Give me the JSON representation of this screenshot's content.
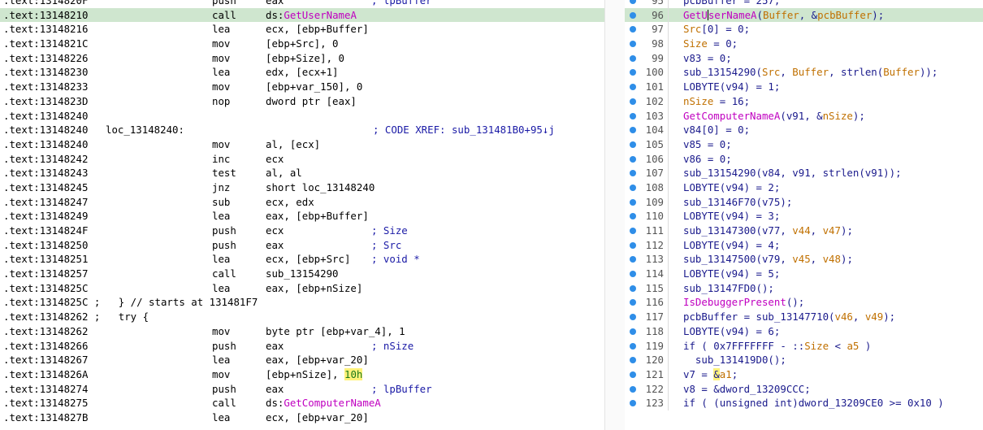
{
  "asm_lines": [
    {
      "addr": ".text:1314820F",
      "label": "",
      "mnemonic": "push",
      "operand": "eax",
      "comment": "; lpBuffer"
    },
    {
      "addr": ".text:13148210",
      "label": "",
      "mnemonic": "call",
      "operand_prefix": "ds:",
      "operand_fn": "GetUserNameA",
      "highlight": true
    },
    {
      "addr": ".text:13148216",
      "label": "",
      "mnemonic": "lea",
      "operand": "ecx, [ebp+Buffer]"
    },
    {
      "addr": ".text:1314821C",
      "label": "",
      "mnemonic": "mov",
      "operand": "[ebp+Src], 0"
    },
    {
      "addr": ".text:13148226",
      "label": "",
      "mnemonic": "mov",
      "operand": "[ebp+Size], 0"
    },
    {
      "addr": ".text:13148230",
      "label": "",
      "mnemonic": "lea",
      "operand": "edx, [ecx+1]"
    },
    {
      "addr": ".text:13148233",
      "label": "",
      "mnemonic": "mov",
      "operand": "[ebp+var_150], 0"
    },
    {
      "addr": ".text:1314823D",
      "label": "",
      "mnemonic": "nop",
      "operand": "dword ptr [eax]"
    },
    {
      "addr": ".text:13148240",
      "label": "",
      "mnemonic": "",
      "operand": ""
    },
    {
      "addr": ".text:13148240",
      "label": "loc_13148240:",
      "mnemonic": "",
      "operand": "",
      "comment": "; CODE XREF: sub_131481B0+95↓j"
    },
    {
      "addr": ".text:13148240",
      "label": "",
      "mnemonic": "mov",
      "operand": "al, [ecx]"
    },
    {
      "addr": ".text:13148242",
      "label": "",
      "mnemonic": "inc",
      "operand": "ecx"
    },
    {
      "addr": ".text:13148243",
      "label": "",
      "mnemonic": "test",
      "operand": "al, al"
    },
    {
      "addr": ".text:13148245",
      "label": "",
      "mnemonic": "jnz",
      "operand": "short loc_13148240"
    },
    {
      "addr": ".text:13148247",
      "label": "",
      "mnemonic": "sub",
      "operand": "ecx, edx"
    },
    {
      "addr": ".text:13148249",
      "label": "",
      "mnemonic": "lea",
      "operand": "eax, [ebp+Buffer]"
    },
    {
      "addr": ".text:1314824F",
      "label": "",
      "mnemonic": "push",
      "operand": "ecx",
      "comment": "; Size"
    },
    {
      "addr": ".text:13148250",
      "label": "",
      "mnemonic": "push",
      "operand": "eax",
      "comment": "; Src"
    },
    {
      "addr": ".text:13148251",
      "label": "",
      "mnemonic": "lea",
      "operand": "ecx, [ebp+Src]",
      "comment": "; void *"
    },
    {
      "addr": ".text:13148257",
      "label": "",
      "mnemonic": "call",
      "operand": "sub_13154290"
    },
    {
      "addr": ".text:1314825C",
      "label": "",
      "mnemonic": "lea",
      "operand": "eax, [ebp+nSize]"
    },
    {
      "full": ".text:1314825C ;   } // starts at 131481F7"
    },
    {
      "full": ".text:13148262 ;   try {"
    },
    {
      "addr": ".text:13148262",
      "label": "",
      "mnemonic": "mov",
      "operand": "byte ptr [ebp+var_4], 1"
    },
    {
      "addr": ".text:13148266",
      "label": "",
      "mnemonic": "push",
      "operand": "eax",
      "comment": "; nSize"
    },
    {
      "addr": ".text:13148267",
      "label": "",
      "mnemonic": "lea",
      "operand": "eax, [ebp+var_20]"
    },
    {
      "addr": ".text:1314826A",
      "label": "",
      "mnemonic": "mov",
      "operand_prefix": "[ebp+nSize], ",
      "operand_hl": "10h"
    },
    {
      "addr": ".text:13148274",
      "label": "",
      "mnemonic": "push",
      "operand": "eax",
      "comment": "; lpBuffer"
    },
    {
      "addr": ".text:13148275",
      "label": "",
      "mnemonic": "call",
      "operand_prefix": "ds:",
      "operand_fn": "GetComputerNameA"
    },
    {
      "addr": ".text:1314827B",
      "label": "",
      "mnemonic": "lea",
      "operand": "ecx, [ebp+var_20]"
    }
  ],
  "pseudo_lines": [
    {
      "n": "95",
      "t": "pcbBuffer = 257;"
    },
    {
      "n": "96",
      "highlight": true,
      "parts": [
        [
          "fnr",
          "GetU"
        ],
        [
          "caret",
          ""
        ],
        [
          "fnr",
          "serNameA"
        ],
        [
          "",
          "("
        ],
        [
          "varr",
          "Buffer"
        ],
        [
          "",
          ", &"
        ],
        [
          "varr",
          "pcbBuffer"
        ],
        [
          "",
          ");"
        ]
      ]
    },
    {
      "n": "97",
      "parts": [
        [
          "varr",
          "Src"
        ],
        [
          "",
          "[0] = 0;"
        ]
      ]
    },
    {
      "n": "98",
      "parts": [
        [
          "varr",
          "Size"
        ],
        [
          "",
          " = 0;"
        ]
      ]
    },
    {
      "n": "99",
      "t": "v83 = 0;"
    },
    {
      "n": "100",
      "parts": [
        [
          "",
          "sub_13154290("
        ],
        [
          "varr",
          "Src"
        ],
        [
          "",
          ", "
        ],
        [
          "varr",
          "Buffer"
        ],
        [
          "",
          ", strlen("
        ],
        [
          "varr",
          "Buffer"
        ],
        [
          "",
          "));"
        ]
      ]
    },
    {
      "n": "101",
      "t": "LOBYTE(v94) = 1;"
    },
    {
      "n": "102",
      "parts": [
        [
          "varr",
          "nSize"
        ],
        [
          "",
          " = 16;"
        ]
      ]
    },
    {
      "n": "103",
      "parts": [
        [
          "fnr",
          "GetComputerNameA"
        ],
        [
          "",
          "(v91, &"
        ],
        [
          "varr",
          "nSize"
        ],
        [
          "",
          ");"
        ]
      ]
    },
    {
      "n": "104",
      "t": "v84[0] = 0;"
    },
    {
      "n": "105",
      "t": "v85 = 0;"
    },
    {
      "n": "106",
      "t": "v86 = 0;"
    },
    {
      "n": "107",
      "t": "sub_13154290(v84, v91, strlen(v91));"
    },
    {
      "n": "108",
      "t": "LOBYTE(v94) = 2;"
    },
    {
      "n": "109",
      "t": "sub_13146F70(v75);"
    },
    {
      "n": "110",
      "t": "LOBYTE(v94) = 3;"
    },
    {
      "n": "111",
      "parts": [
        [
          "",
          "sub_13147300(v77, "
        ],
        [
          "varr",
          "v44"
        ],
        [
          "",
          ", "
        ],
        [
          "varr",
          "v47"
        ],
        [
          "",
          ");"
        ]
      ]
    },
    {
      "n": "112",
      "t": "LOBYTE(v94) = 4;"
    },
    {
      "n": "113",
      "parts": [
        [
          "",
          "sub_13147500(v79, "
        ],
        [
          "varr",
          "v45"
        ],
        [
          "",
          ", "
        ],
        [
          "varr",
          "v48"
        ],
        [
          "",
          ");"
        ]
      ]
    },
    {
      "n": "114",
      "t": "LOBYTE(v94) = 5;"
    },
    {
      "n": "115",
      "t": "sub_13147FD0();"
    },
    {
      "n": "116",
      "parts": [
        [
          "fnr",
          "IsDebuggerPresent"
        ],
        [
          "",
          "();"
        ]
      ]
    },
    {
      "n": "117",
      "parts": [
        [
          "",
          "pcbBuffer = sub_13147710("
        ],
        [
          "varr",
          "v46"
        ],
        [
          "",
          ", "
        ],
        [
          "varr",
          "v49"
        ],
        [
          "",
          ");"
        ]
      ]
    },
    {
      "n": "118",
      "t": "LOBYTE(v94) = 6;"
    },
    {
      "n": "119",
      "parts": [
        [
          "",
          "if ( 0x7FFFFFFF - ::"
        ],
        [
          "varr",
          "Size"
        ],
        [
          "",
          " < "
        ],
        [
          "varr",
          "a5"
        ],
        [
          "",
          " )"
        ]
      ]
    },
    {
      "n": "120",
      "t": "  sub_131419D0();"
    },
    {
      "n": "121",
      "parts": [
        [
          "",
          "v7 = "
        ],
        [
          "yhl",
          "&"
        ],
        [
          "varr",
          "a1"
        ],
        [
          "",
          ";"
        ]
      ]
    },
    {
      "n": "122",
      "t": "v8 = &dword_13209CCC;"
    },
    {
      "n": "123",
      "t": "if ( (unsigned int)dword_13209CE0 >= 0x10 )"
    }
  ]
}
